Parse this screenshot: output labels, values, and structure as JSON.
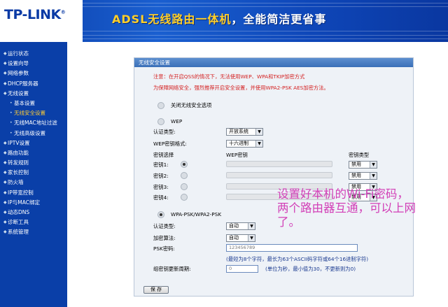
{
  "header": {
    "logo": "TP-LINK",
    "logo_reg": "®",
    "banner_prefix": "ADSL",
    "banner_highlight": "无线路由一体机",
    "banner_suffix": "，全能简洁更省事"
  },
  "sidebar": {
    "items": [
      {
        "label": "运行状态",
        "sub": false
      },
      {
        "label": "设置向导",
        "sub": false
      },
      {
        "label": "网络参数",
        "sub": false
      },
      {
        "label": "DHCP服务器",
        "sub": false
      },
      {
        "label": "无线设置",
        "sub": false
      },
      {
        "label": "基本设置",
        "sub": true
      },
      {
        "label": "无线安全设置",
        "sub": true,
        "active": true
      },
      {
        "label": "无线MAC地址过滤",
        "sub": true
      },
      {
        "label": "无线高级设置",
        "sub": true
      },
      {
        "label": "IPTV设置",
        "sub": false
      },
      {
        "label": "路由功能",
        "sub": false
      },
      {
        "label": "转发规则",
        "sub": false
      },
      {
        "label": "家长控制",
        "sub": false
      },
      {
        "label": "防火墙",
        "sub": false
      },
      {
        "label": "IP带宽控制",
        "sub": false
      },
      {
        "label": "IP与MAC绑定",
        "sub": false
      },
      {
        "label": "动态DNS",
        "sub": false
      },
      {
        "label": "诊断工具",
        "sub": false
      },
      {
        "label": "系统管理",
        "sub": false
      }
    ]
  },
  "panel": {
    "title": "无线安全设置",
    "note1": "注意：在开启QSS的情况下，无法使用WEP、WPA和TKIP加密方式",
    "note2": "为保障网络安全，强烈推荐开启安全设置，并使用WPA2-PSK AES加密方法。",
    "opt_disable": "关闭无线安全选项",
    "opt_wep": "WEP",
    "auth_label": "认证类型:",
    "auth_value": "开放系统",
    "wep_fmt_label": "WEP密钥格式:",
    "wep_fmt_value": "十六进制",
    "col_key_select": "密钥选择",
    "col_wep_key": "WEP密钥",
    "col_key_type": "密钥类型",
    "keys": [
      "密钥1:",
      "密钥2:",
      "密钥3:",
      "密钥4:"
    ],
    "key_type_value": "禁用",
    "opt_wpa": "WPA-PSK/WPA2-PSK",
    "wpa_auth_label": "认证类型:",
    "wpa_auth_value": "自动",
    "enc_label": "加密算法:",
    "enc_value": "自动",
    "psk_label": "PSK密码:",
    "psk_value": "123456789",
    "psk_hint": "(最短为8个字符，最长为63个ASCII码字符或64个16进制字符)",
    "renew_label": "组密钥更新周期:",
    "renew_value": "0",
    "renew_hint": "(单位为秒，最小值为30，不更新则为0)",
    "save": "保 存"
  },
  "annotation": {
    "text": "设置好本机的Wi-Fi密码，两个路由器互通，可以上网了。"
  },
  "colors": {
    "header_blue": "#1a5fd0",
    "sidebar_blue": "#0a3fa8",
    "active_nav": "#ffcc33",
    "note_red": "#d41f1f",
    "annotation_pink": "#d23fb7"
  }
}
